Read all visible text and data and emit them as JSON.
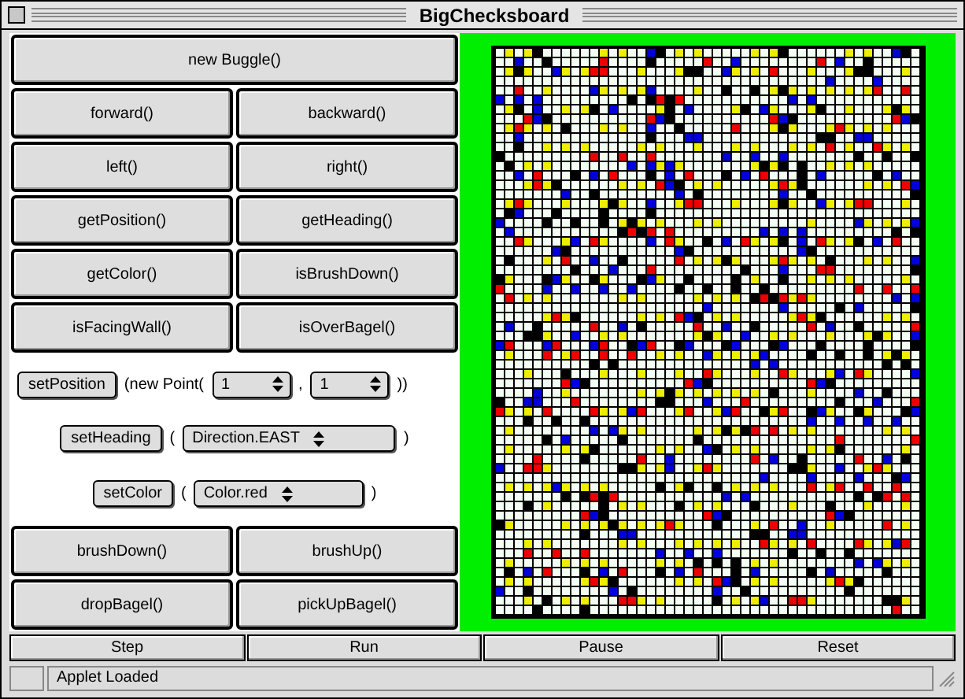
{
  "window": {
    "title": "BigChecksboard"
  },
  "button_rows_top": [
    {
      "buttons": [
        "new Buggle()"
      ]
    },
    {
      "buttons": [
        "forward()",
        "backward()"
      ]
    },
    {
      "buttons": [
        "left()",
        "right()"
      ]
    },
    {
      "buttons": [
        "getPosition()",
        "getHeading()"
      ]
    },
    {
      "buttons": [
        "getColor()",
        "isBrushDown()"
      ]
    },
    {
      "buttons": [
        "isFacingWall()",
        "isOverBagel()"
      ]
    }
  ],
  "setters": [
    {
      "parts": [
        {
          "kind": "button",
          "text": "setPosition"
        },
        {
          "kind": "text",
          "text": "(new Point("
        },
        {
          "kind": "select",
          "text": "1"
        },
        {
          "kind": "text",
          "text": ","
        },
        {
          "kind": "select",
          "text": "1"
        },
        {
          "kind": "text",
          "text": "))"
        }
      ]
    },
    {
      "parts": [
        {
          "kind": "button",
          "text": "setHeading"
        },
        {
          "kind": "text",
          "text": "("
        },
        {
          "kind": "select",
          "text": "Direction.EAST"
        },
        {
          "kind": "text",
          "text": ")"
        }
      ]
    },
    {
      "parts": [
        {
          "kind": "button",
          "text": "setColor"
        },
        {
          "kind": "text",
          "text": "("
        },
        {
          "kind": "select",
          "text": "Color.red"
        },
        {
          "kind": "text",
          "text": ")"
        }
      ]
    }
  ],
  "button_rows_bottom": [
    {
      "buttons": [
        "brushDown()",
        "brushUp()"
      ]
    },
    {
      "buttons": [
        "dropBagel()",
        "pickUpBagel()"
      ]
    }
  ],
  "control_buttons": [
    "Step",
    "Run",
    "Pause",
    "Reset"
  ],
  "status_bar": "Applet Loaded"
}
